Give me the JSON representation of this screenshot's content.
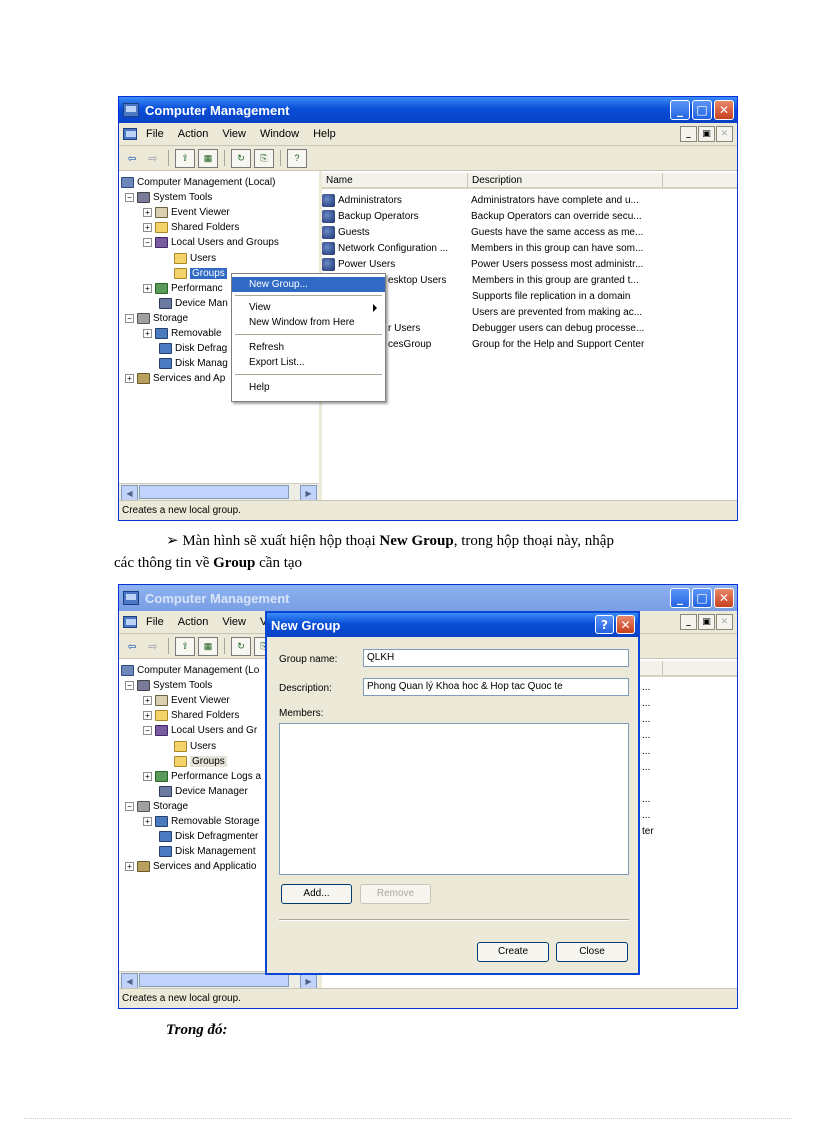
{
  "screen1": {
    "window_title": "Computer Management",
    "menu": [
      "File",
      "Action",
      "View",
      "Window",
      "Help"
    ],
    "mdi_buttons": [
      "_",
      "▣",
      "✕"
    ],
    "toolbar_glyphs": [
      "⇦",
      "⇨",
      "⇪",
      "▦",
      "↻",
      "⎘",
      "?"
    ],
    "tree": {
      "root": "Computer Management (Local)",
      "system_tools": "System Tools",
      "event_viewer": "Event Viewer",
      "shared_folders": "Shared Folders",
      "local_users_groups": "Local Users and Groups",
      "users": "Users",
      "groups": "Groups",
      "performance": "Performanc",
      "device_manager": "Device Man",
      "storage": "Storage",
      "removable": "Removable",
      "disk_defrag": "Disk Defrag",
      "disk_manag": "Disk Manag",
      "services": "Services and Ap"
    },
    "list_columns": {
      "name": "Name",
      "description": "Description"
    },
    "rows": [
      {
        "name": "Administrators",
        "description": "Administrators have complete and u..."
      },
      {
        "name": "Backup Operators",
        "description": "Backup Operators can override secu..."
      },
      {
        "name": "Guests",
        "description": "Guests have the same access as me..."
      },
      {
        "name": "Network Configuration ...",
        "description": "Members in this group can have som..."
      },
      {
        "name": "Power Users",
        "description": "Power Users possess most administr..."
      },
      {
        "name": "esktop Users",
        "description": "Members in this group are granted t..."
      },
      {
        "name": "",
        "description": "Supports file replication in a domain"
      },
      {
        "name": "",
        "description": "Users are prevented from making ac..."
      },
      {
        "name": "r Users",
        "description": "Debugger users can debug processe..."
      },
      {
        "name": "cesGroup",
        "description": "Group for the Help and Support Center"
      }
    ],
    "context_menu": {
      "new_group": "New Group...",
      "view": "View",
      "new_window": "New Window from Here",
      "refresh": "Refresh",
      "export_list": "Export List...",
      "help": "Help"
    },
    "status": "Creates a new local group."
  },
  "caption": {
    "bullet": "➢",
    "text_1": " Màn hình sẽ xuất hiện hộp thoại ",
    "bold_1": "New Group",
    "text_2": ", trong hộp thoại này, nhập",
    "text_3": "các thông tin về ",
    "bold_2": "Group",
    "text_4": " cần tạo"
  },
  "screen2": {
    "window_title": "Computer Management",
    "menu": [
      "File",
      "Action",
      "View",
      "V"
    ],
    "mdi_buttons": [
      "_",
      "▣",
      "✕"
    ],
    "tree": {
      "root": "Computer Management (Lo",
      "system_tools": "System Tools",
      "event_viewer": "Event Viewer",
      "shared_folders": "Shared Folders",
      "local_users_groups": "Local Users and Gr",
      "users": "Users",
      "groups": "Groups",
      "performance": "Performance Logs a",
      "device_manager": "Device Manager",
      "storage": "Storage",
      "removable": "Removable Storage",
      "disk_defrag": "Disk Defragmenter",
      "disk_manag": "Disk Management",
      "services": "Services and Applicatio"
    },
    "list_fragments": [
      "...",
      "...",
      "...",
      "...",
      "...",
      "...",
      "...",
      "...",
      "ter"
    ],
    "status": "Creates a new local group.",
    "dialog": {
      "title": "New Group",
      "help_glyph": "?",
      "close_glyph": "✕",
      "group_name_label": "Group name:",
      "group_name_value": "QLKH",
      "description_label": "Description:",
      "description_value": "Phong Quan lý Khoa hoc & Hop tac Quoc te",
      "members_label": "Members:",
      "add": "Add...",
      "remove": "Remove",
      "create": "Create",
      "close": "Close"
    }
  },
  "trong_do": "Trong đó:"
}
